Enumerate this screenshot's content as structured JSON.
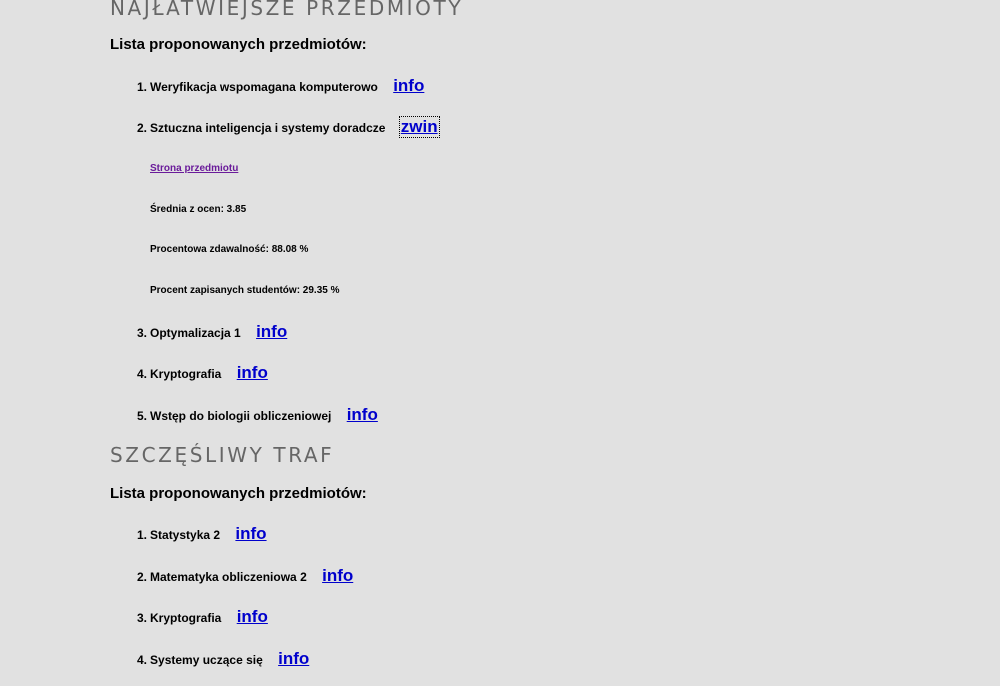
{
  "sections": [
    {
      "title": "NAJŁATWIEJSZE PRZEDMIOTY",
      "list_heading": "Lista proponowanych przedmiotów:",
      "items": [
        {
          "num": "1.",
          "label": "Weryfikacja wspomagana komputerowo",
          "link": "info"
        },
        {
          "num": "2.",
          "label": "Sztuczna inteligencja i systemy doradcze",
          "link": "zwin"
        },
        {
          "num": "3.",
          "label": "Optymalizacja 1",
          "link": "info"
        },
        {
          "num": "4.",
          "label": "Kryptografia",
          "link": "info"
        },
        {
          "num": "5.",
          "label": "Wstęp do biologii obliczeniowej",
          "link": "info"
        }
      ],
      "expanded_details": {
        "page_link": "Strona przedmiotu",
        "average": "Średnia z ocen: 3.85",
        "pass_rate": "Procentowa zdawalność: 88.08 %",
        "enrolled": "Procent zapisanych studentów: 29.35 %"
      }
    },
    {
      "title": "SZCZĘŚLIWY TRAF",
      "list_heading": "Lista proponowanych przedmiotów:",
      "items": [
        {
          "num": "1.",
          "label": "Statystyka 2",
          "link": "info"
        },
        {
          "num": "2.",
          "label": "Matematyka obliczeniowa 2",
          "link": "info"
        },
        {
          "num": "3.",
          "label": "Kryptografia",
          "link": "info"
        },
        {
          "num": "4.",
          "label": "Systemy uczące się",
          "link": "info"
        }
      ]
    }
  ],
  "colors": {
    "background": "#e1e1e1",
    "section_title": "#666666",
    "link": "#0000cc",
    "visited_link": "#6a1b9a"
  }
}
